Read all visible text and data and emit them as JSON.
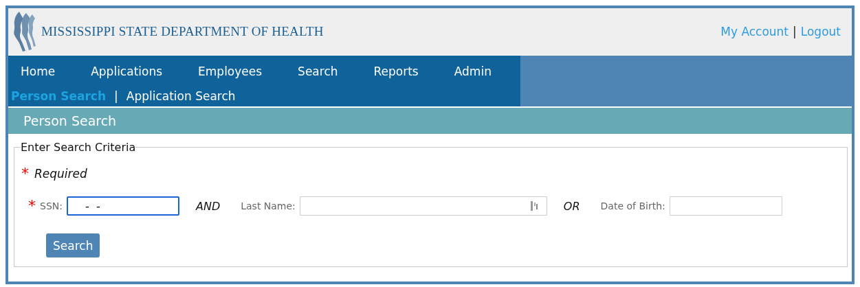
{
  "header": {
    "title": "MISSISSIPPI STATE DEPARTMENT OF HEALTH",
    "links": [
      {
        "label": "My Account"
      },
      {
        "label": "Logout"
      }
    ],
    "separator": "|"
  },
  "nav": {
    "items": [
      {
        "label": "Home",
        "selected": false
      },
      {
        "label": "Applications",
        "selected": false
      },
      {
        "label": "Employees",
        "selected": false
      },
      {
        "label": "Search",
        "selected": false
      },
      {
        "label": "Reports",
        "selected": false
      },
      {
        "label": "Admin",
        "selected": false
      }
    ],
    "subitems": [
      {
        "label": "Person Search",
        "selected": true
      },
      {
        "label": "Application Search",
        "selected": false
      }
    ],
    "separator": "|"
  },
  "page_title": "Person Search",
  "form": {
    "legend": "Enter Search Criteria",
    "required_mark": "*",
    "required_note": "Required",
    "fields": [
      {
        "kind": "field",
        "label": "SSN:",
        "required": true,
        "value": " -  -",
        "focused": true,
        "has_icon": false
      },
      {
        "kind": "conjunction",
        "text": "AND"
      },
      {
        "kind": "field",
        "label": "Last Name:",
        "required": false,
        "focused": false,
        "has_icon": true
      },
      {
        "kind": "conjunction",
        "text": "OR"
      },
      {
        "kind": "field",
        "label": "Date of Birth:",
        "required": false,
        "focused": false,
        "has_icon": false
      }
    ],
    "button": "Search"
  }
}
